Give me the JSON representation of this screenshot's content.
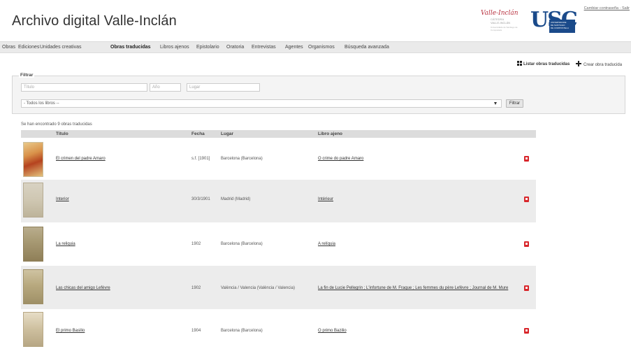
{
  "header": {
    "site_title": "Archivo digital Valle-Inclán",
    "top_links": "Cambiar contraseña - Salir",
    "catedra_logo": {
      "signature": "Valle-Inclán",
      "line1": "CÁTEDRA",
      "line2": "VALLE-INCLÁN",
      "line3": "Universidade de Santiago de Compostela"
    },
    "usc_logo": {
      "letters": "USC",
      "line1": "UNIVERSIDADE",
      "line2": "DE SANTIAGO",
      "line3": "DE COMPOSTELA"
    }
  },
  "nav": {
    "items": [
      "Obras",
      "Ediciones",
      "Unidades creativas",
      "Obras traducidas",
      "Libros ajenos",
      "Epistolario",
      "Oratoria",
      "Entrevistas",
      "Agentes",
      "Organismos",
      "Búsqueda avanzada"
    ],
    "active": "Obras traducidas"
  },
  "actions": {
    "list_label": "Listar obras traducidas",
    "create_label": "Crear obra traducida"
  },
  "filter": {
    "legend": "Filtrar",
    "titulo_placeholder": "Título",
    "anio_placeholder": "Año",
    "lugar_placeholder": "Lugar",
    "libros_selected": "- Todos los libros --",
    "button_label": "Filtrar"
  },
  "result_count": "Se han encontrado 9 obras traducidas",
  "table": {
    "headers": [
      "Título",
      "Fecha",
      "Lugar",
      "Libro ajeno"
    ],
    "rows": [
      {
        "titulo": "El crimen del padre Amaro",
        "fecha": "s.f. [1901]",
        "lugar": "Barcelona (Barcelona)",
        "libro": "O crime do padre Amaro"
      },
      {
        "titulo": "Interior",
        "fecha": "30/3/1901",
        "lugar": "Madrid (Madrid)",
        "libro": "Intérieur"
      },
      {
        "titulo": "La reliquia",
        "fecha": "1902",
        "lugar": "Barcelona (Barcelona)",
        "libro": "A relíquia"
      },
      {
        "titulo": "Las chicas del amigo Lefèvre",
        "fecha": "1902",
        "lugar": "València / Valencia (València / Valencia)",
        "libro": "La fin de Lucie Pellegrin ; L'infortune de M. Fraque ; Les femmes du père Lefèvre ; Journal de M. Mure"
      },
      {
        "titulo": "El primo Basilio",
        "fecha": "1904",
        "lugar": "Barcelona (Barcelona)",
        "libro": "O primo Bazilio"
      }
    ]
  },
  "icons": {
    "pdf": "pdf-icon",
    "list": "grid-icon",
    "create": "plus-icon"
  },
  "colors": {
    "usc_blue": "#1a4a8a",
    "pdf_red": "#d8262b",
    "catedra_red": "#b8313f",
    "nav_bg": "#eaeaea"
  }
}
